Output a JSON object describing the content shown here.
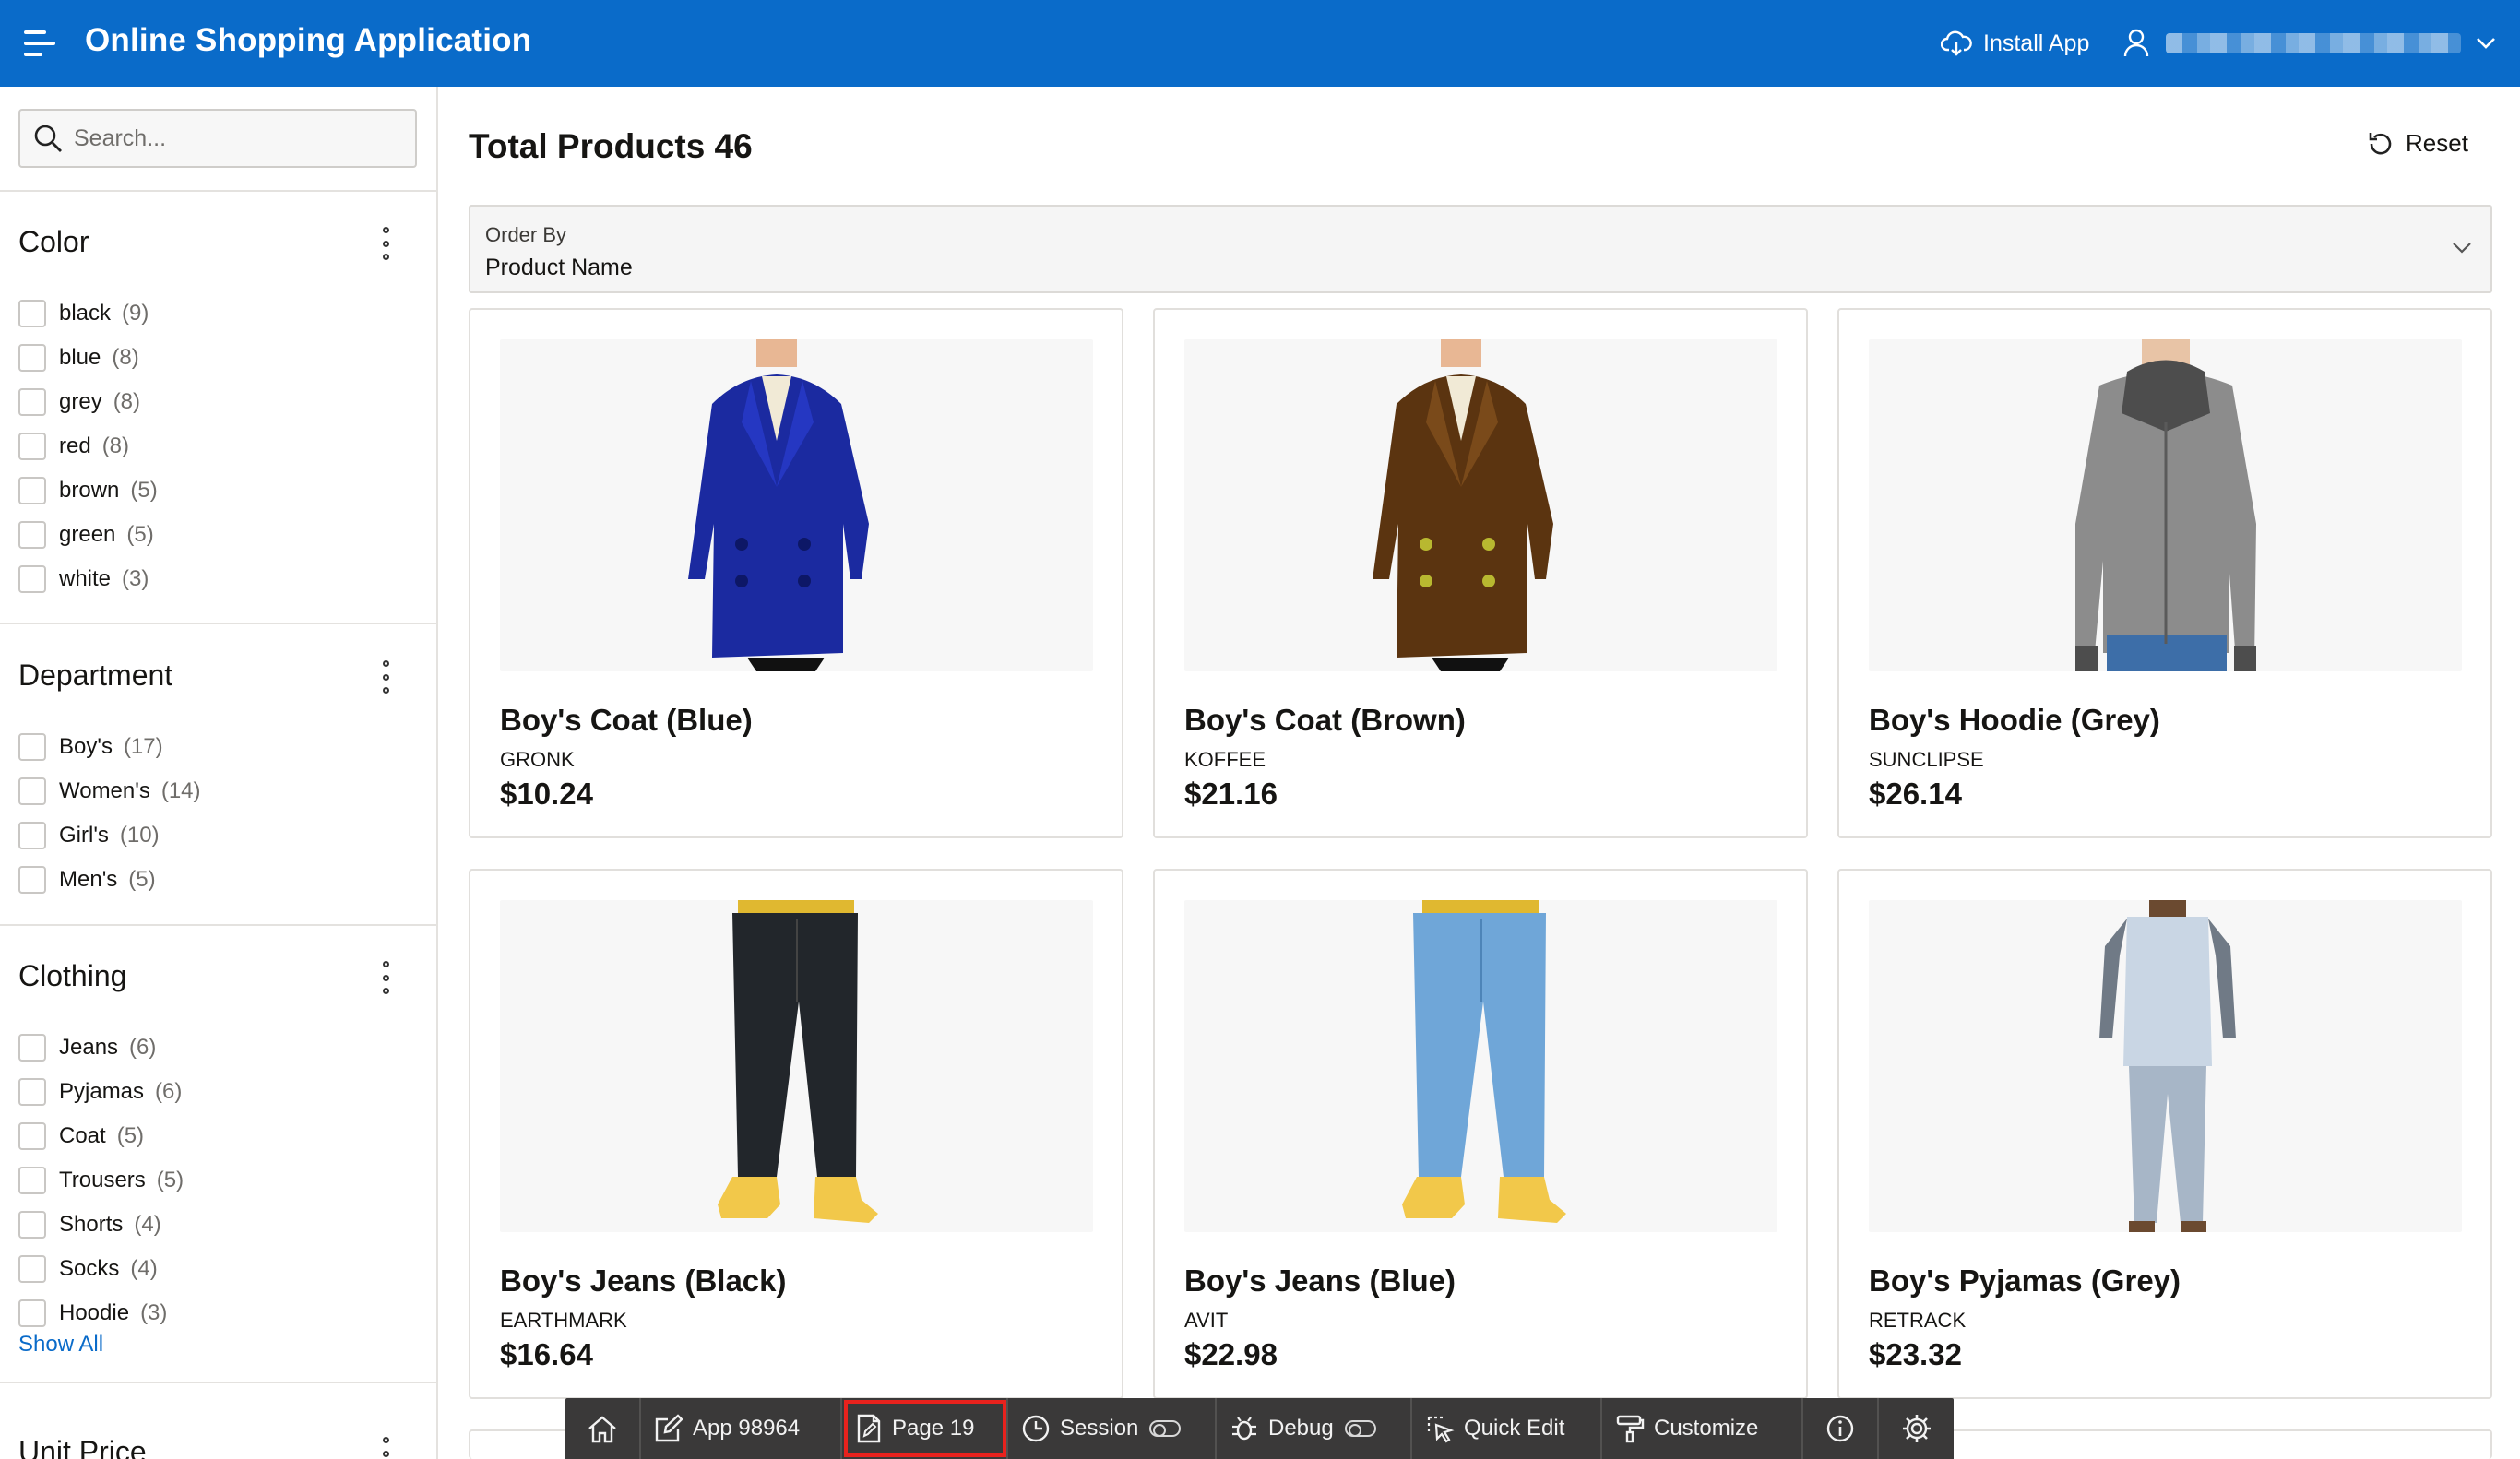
{
  "header": {
    "title": "Online Shopping Application",
    "install_label": "Install App"
  },
  "sidebar": {
    "search_placeholder": "Search...",
    "facets": [
      {
        "title": "Color",
        "options": [
          {
            "label": "black",
            "count": "(9)"
          },
          {
            "label": "blue",
            "count": "(8)"
          },
          {
            "label": "grey",
            "count": "(8)"
          },
          {
            "label": "red",
            "count": "(8)"
          },
          {
            "label": "brown",
            "count": "(5)"
          },
          {
            "label": "green",
            "count": "(5)"
          },
          {
            "label": "white",
            "count": "(3)"
          }
        ]
      },
      {
        "title": "Department",
        "options": [
          {
            "label": "Boy's",
            "count": "(17)"
          },
          {
            "label": "Women's",
            "count": "(14)"
          },
          {
            "label": "Girl's",
            "count": "(10)"
          },
          {
            "label": "Men's",
            "count": "(5)"
          }
        ]
      },
      {
        "title": "Clothing",
        "options": [
          {
            "label": "Jeans",
            "count": "(6)"
          },
          {
            "label": "Pyjamas",
            "count": "(6)"
          },
          {
            "label": "Coat",
            "count": "(5)"
          },
          {
            "label": "Trousers",
            "count": "(5)"
          },
          {
            "label": "Shorts",
            "count": "(4)"
          },
          {
            "label": "Socks",
            "count": "(4)"
          },
          {
            "label": "Hoodie",
            "count": "(3)"
          }
        ],
        "show_all": "Show All"
      },
      {
        "title": "Unit Price"
      }
    ]
  },
  "main": {
    "title": "Total Products 46",
    "reset_label": "Reset",
    "order_by": {
      "label": "Order By",
      "value": "Product Name"
    },
    "products": [
      {
        "name": "Boy's Coat (Blue)",
        "brand": "GRONK",
        "price": "$10.24",
        "image": "coat-blue"
      },
      {
        "name": "Boy's Coat (Brown)",
        "brand": "KOFFEE",
        "price": "$21.16",
        "image": "coat-brown"
      },
      {
        "name": "Boy's Hoodie (Grey)",
        "brand": "SUNCLIPSE",
        "price": "$26.14",
        "image": "hoodie-grey"
      },
      {
        "name": "Boy's Jeans (Black)",
        "brand": "EARTHMARK",
        "price": "$16.64",
        "image": "jeans-black"
      },
      {
        "name": "Boy's Jeans (Blue)",
        "brand": "AVIT",
        "price": "$22.98",
        "image": "jeans-blue"
      },
      {
        "name": "Boy's Pyjamas (Grey)",
        "brand": "RETRACK",
        "price": "$23.32",
        "image": "pyjamas-grey"
      }
    ]
  },
  "dev_toolbar": {
    "app_label": "App 98964",
    "page_label": "Page 19",
    "session_label": "Session",
    "debug_label": "Debug",
    "quick_edit_label": "Quick Edit",
    "customize_label": "Customize"
  },
  "colors": {
    "header_bg": "#0a6bc9",
    "link": "#0a6bc9",
    "toolbar_bg": "#3a3939",
    "highlight": "#e8221d"
  }
}
